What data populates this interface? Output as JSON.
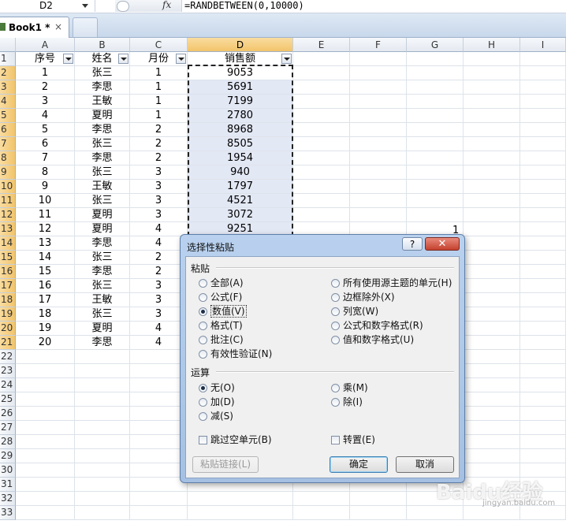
{
  "formula_bar": {
    "name_box": "D2",
    "fx": "fx",
    "formula": "=RANDBETWEEN(0,10000)"
  },
  "tabs": [
    {
      "label": "Book1 *",
      "close": "×"
    }
  ],
  "columns": [
    "A",
    "B",
    "C",
    "D",
    "E",
    "F",
    "G",
    "H",
    "I"
  ],
  "headers": {
    "a": "序号",
    "b": "姓名",
    "c": "月份",
    "d": "销售额"
  },
  "rows": [
    [
      "1",
      "张三",
      "1",
      "9053"
    ],
    [
      "2",
      "李思",
      "1",
      "5691"
    ],
    [
      "3",
      "王敏",
      "1",
      "7199"
    ],
    [
      "4",
      "夏明",
      "1",
      "2780"
    ],
    [
      "5",
      "李思",
      "2",
      "8968"
    ],
    [
      "6",
      "张三",
      "2",
      "8505"
    ],
    [
      "7",
      "李思",
      "2",
      "1954"
    ],
    [
      "8",
      "张三",
      "3",
      "940"
    ],
    [
      "9",
      "王敏",
      "3",
      "1797"
    ],
    [
      "10",
      "张三",
      "3",
      "4521"
    ],
    [
      "11",
      "夏明",
      "3",
      "3072"
    ],
    [
      "12",
      "夏明",
      "4",
      "9251"
    ],
    [
      "13",
      "李思",
      "4",
      ""
    ],
    [
      "14",
      "张三",
      "2",
      ""
    ],
    [
      "15",
      "李思",
      "2",
      ""
    ],
    [
      "16",
      "张三",
      "3",
      ""
    ],
    [
      "17",
      "王敏",
      "3",
      ""
    ],
    [
      "18",
      "张三",
      "3",
      ""
    ],
    [
      "19",
      "夏明",
      "4",
      ""
    ],
    [
      "20",
      "李思",
      "4",
      ""
    ]
  ],
  "row_numbers": [
    "1",
    "2",
    "3",
    "4",
    "5",
    "6",
    "7",
    "8",
    "9",
    "10",
    "11",
    "12",
    "13",
    "14",
    "15",
    "16",
    "17",
    "18",
    "19",
    "20",
    "21",
    "22",
    "23",
    "24",
    "25",
    "26",
    "27",
    "28",
    "29",
    "30",
    "31",
    "32",
    "33"
  ],
  "stray_cell_g13": "1",
  "dialog": {
    "title": "选择性粘贴",
    "help": "?",
    "close": "✕",
    "paste_section": "粘贴",
    "paste_options_left": [
      "全部(A)",
      "公式(F)",
      "数值(V)",
      "格式(T)",
      "批注(C)",
      "有效性验证(N)"
    ],
    "paste_options_right": [
      "所有使用源主题的单元(H)",
      "边框除外(X)",
      "列宽(W)",
      "公式和数字格式(R)",
      "值和数字格式(U)"
    ],
    "paste_selected": "数值(V)",
    "op_section": "运算",
    "op_left": [
      "无(O)",
      "加(D)",
      "减(S)"
    ],
    "op_right": [
      "乘(M)",
      "除(I)"
    ],
    "op_selected": "无(O)",
    "skip_blanks": "跳过空单元(B)",
    "transpose": "转置(E)",
    "paste_link": "粘贴链接(L)",
    "ok": "确定",
    "cancel": "取消"
  },
  "watermark": {
    "brand": "Baidu经验",
    "url": "jingyan.baidu.com"
  }
}
